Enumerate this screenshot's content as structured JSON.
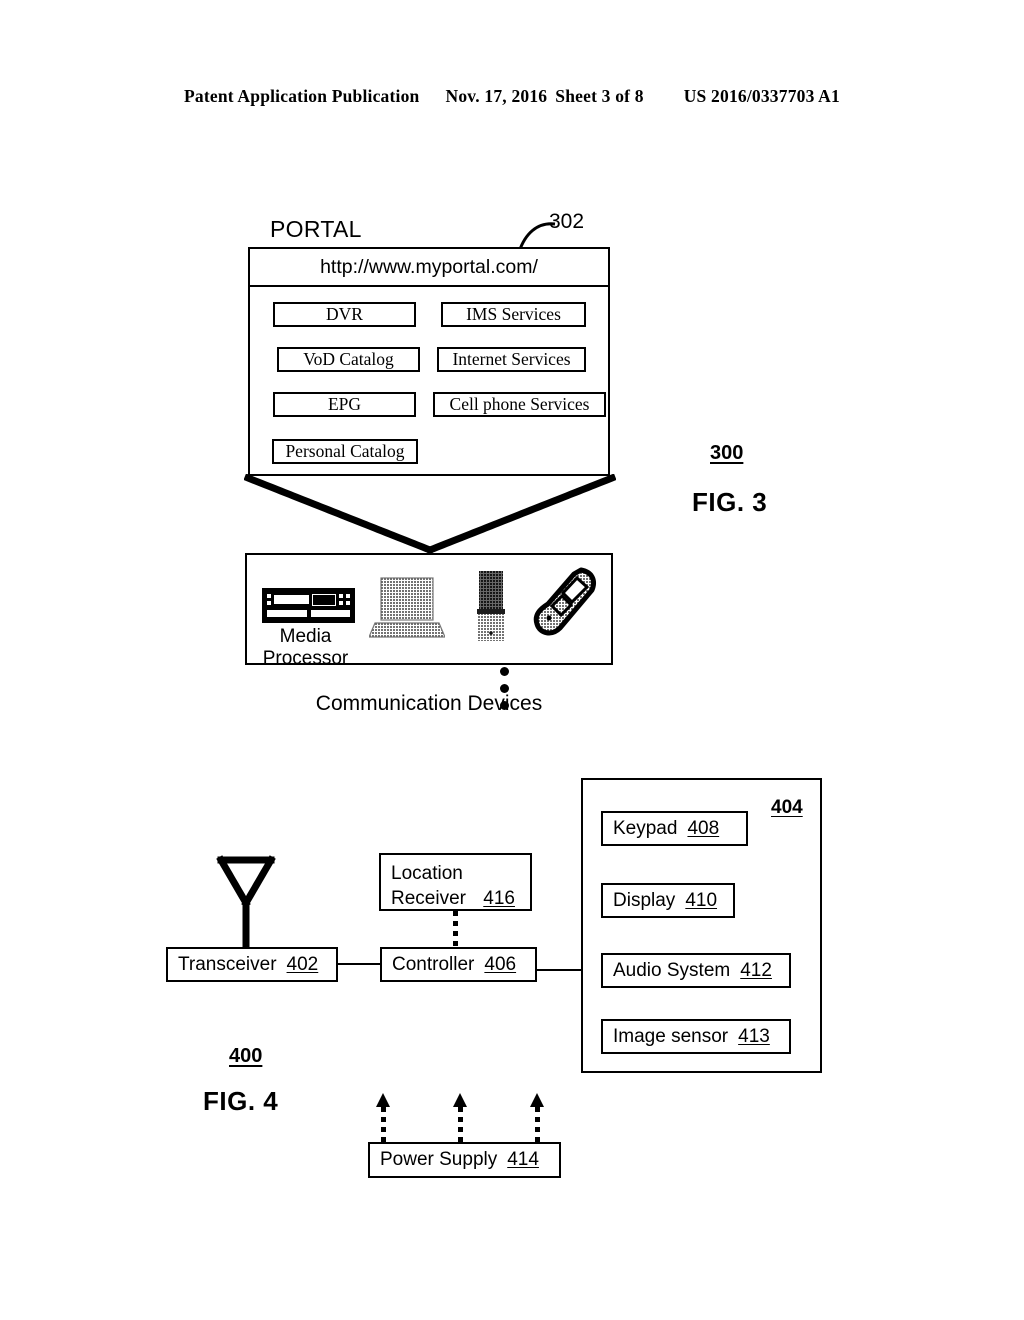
{
  "header": {
    "publication": "Patent Application Publication",
    "date": "Nov. 17, 2016",
    "sheet": "Sheet 3 of 8",
    "patent_number": "US 2016/0337703 A1"
  },
  "fig3": {
    "figure_label": "FIG. 3",
    "figure_ref": "300",
    "portal_ref": "302",
    "portal_title": "PORTAL",
    "url": "http://www.myportal.com/",
    "left_buttons": [
      {
        "label": "DVR"
      },
      {
        "label": "VoD Catalog"
      },
      {
        "label": "EPG"
      },
      {
        "label": "Personal Catalog"
      }
    ],
    "right_buttons": [
      {
        "label": "IMS Services"
      },
      {
        "label": "Internet Services"
      },
      {
        "label": "Cell phone Services"
      }
    ],
    "ellipsis_dots": 3,
    "devices_caption": "Communication Devices",
    "devices": [
      {
        "name": "media-processor",
        "label": "Media\nProcessor",
        "label_line1": "Media",
        "label_line2": "Processor"
      },
      {
        "name": "laptop-computer",
        "label": ""
      },
      {
        "name": "cordless-phone",
        "label": ""
      },
      {
        "name": "flip-phone",
        "label": ""
      }
    ]
  },
  "fig4": {
    "figure_label": "FIG. 4",
    "figure_ref": "400",
    "device_group_ref": "404",
    "blocks": {
      "transceiver": {
        "label": "Transceiver",
        "ref": "402"
      },
      "controller": {
        "label": "Controller",
        "ref": "406"
      },
      "location_receiver": {
        "label_line1": "Location",
        "label_line2": "Receiver",
        "ref": "416"
      },
      "keypad": {
        "label": "Keypad",
        "ref": "408"
      },
      "display": {
        "label": "Display",
        "ref": "410"
      },
      "audio_system": {
        "label": "Audio System",
        "ref": "412"
      },
      "image_sensor": {
        "label": "Image sensor",
        "ref": "413"
      },
      "power_supply": {
        "label": "Power Supply",
        "ref": "414"
      }
    },
    "power_arrows": 3
  },
  "colors": {
    "ink": "#000000",
    "paper": "#ffffff"
  }
}
